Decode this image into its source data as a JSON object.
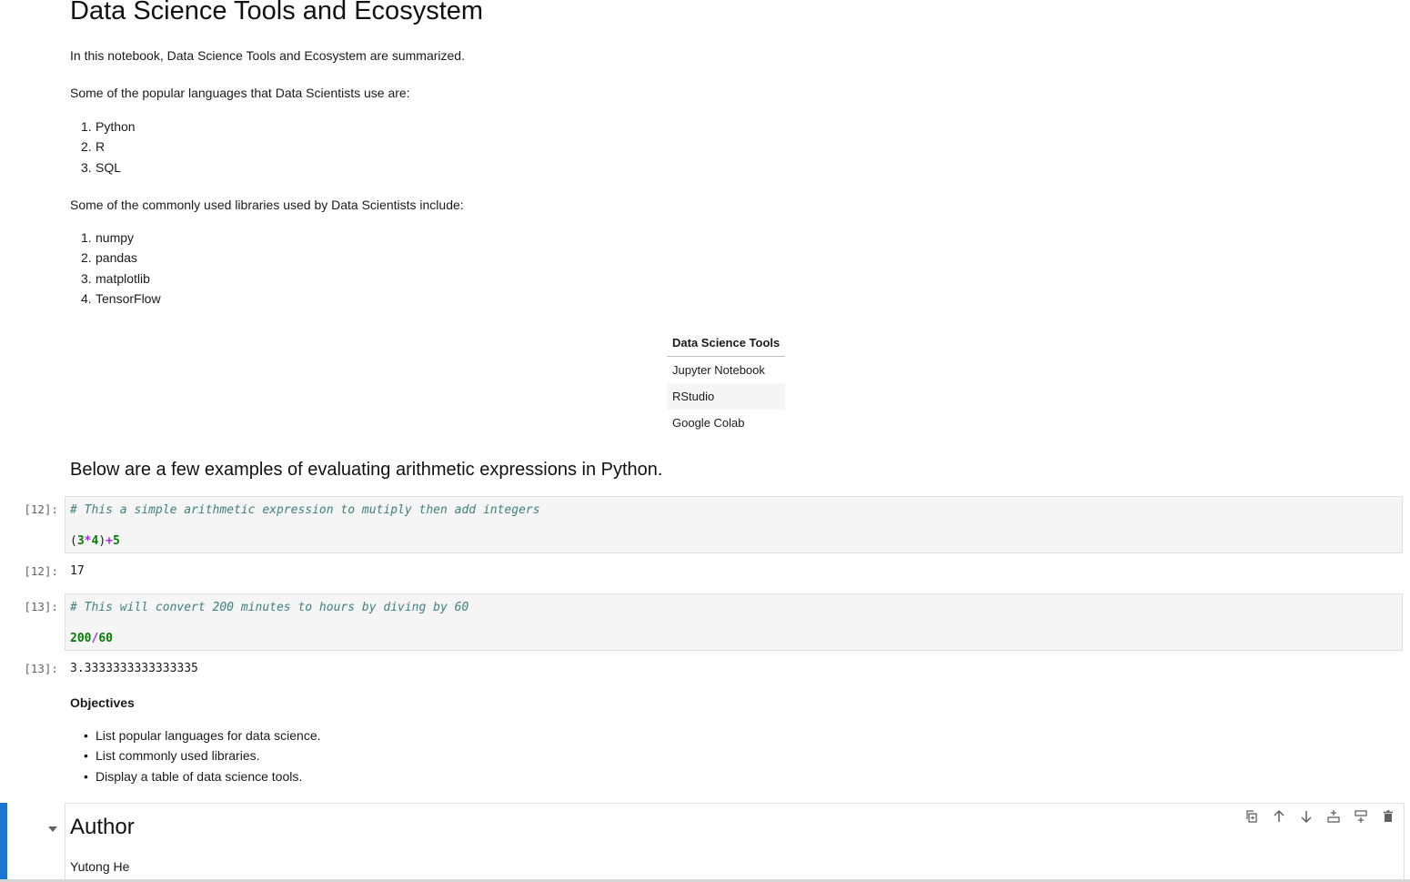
{
  "notebook": {
    "title": "Data Science Tools and Ecosystem",
    "intro": "In this notebook, Data Science Tools and Ecosystem are summarized.",
    "languages_heading": "Some of the popular languages that Data Scientists use are:",
    "languages": [
      "Python",
      "R",
      "SQL"
    ],
    "libraries_heading": "Some of the commonly used libraries used by Data Scientists include:",
    "libraries": [
      "numpy",
      "pandas",
      "matplotlib",
      "TensorFlow"
    ],
    "tools_table": {
      "header": "Data Science Tools",
      "rows": [
        "Jupyter Notebook",
        "RStudio",
        "Google Colab"
      ]
    },
    "arith_heading": "Below are a few examples of evaluating arithmetic expressions in Python.",
    "cells": [
      {
        "prompt_in": "[12]:",
        "comment": "# This a simple arithmetic expression to mutiply then add integers",
        "code_tokens": [
          {
            "t": "(",
            "c": "pn"
          },
          {
            "t": "3",
            "c": "nm"
          },
          {
            "t": "*",
            "c": "op"
          },
          {
            "t": "4",
            "c": "nm"
          },
          {
            "t": ")",
            "c": "pn"
          },
          {
            "t": "+",
            "c": "op"
          },
          {
            "t": "5",
            "c": "nm"
          }
        ],
        "prompt_out": "[12]:",
        "output": "17"
      },
      {
        "prompt_in": "[13]:",
        "comment": "# This will convert 200 minutes to hours by diving by 60",
        "code_tokens": [
          {
            "t": "200",
            "c": "nm"
          },
          {
            "t": "/",
            "c": "op"
          },
          {
            "t": "60",
            "c": "nm"
          }
        ],
        "prompt_out": "[13]:",
        "output": "3.3333333333333335"
      }
    ],
    "objectives_heading": "Objectives",
    "objectives": [
      "List popular languages for data science.",
      "List commonly used libraries.",
      "Display a table of data science tools."
    ],
    "author_heading": "Author",
    "author_name": "Yutong He"
  },
  "toolbar_icons": [
    "duplicate-icon",
    "move-up-icon",
    "move-down-icon",
    "insert-above-icon",
    "insert-below-icon",
    "delete-icon"
  ],
  "colors": {
    "active_cell": "#1976d2",
    "comment": "#408080",
    "number": "#008000",
    "operator": "#aa22ff"
  }
}
